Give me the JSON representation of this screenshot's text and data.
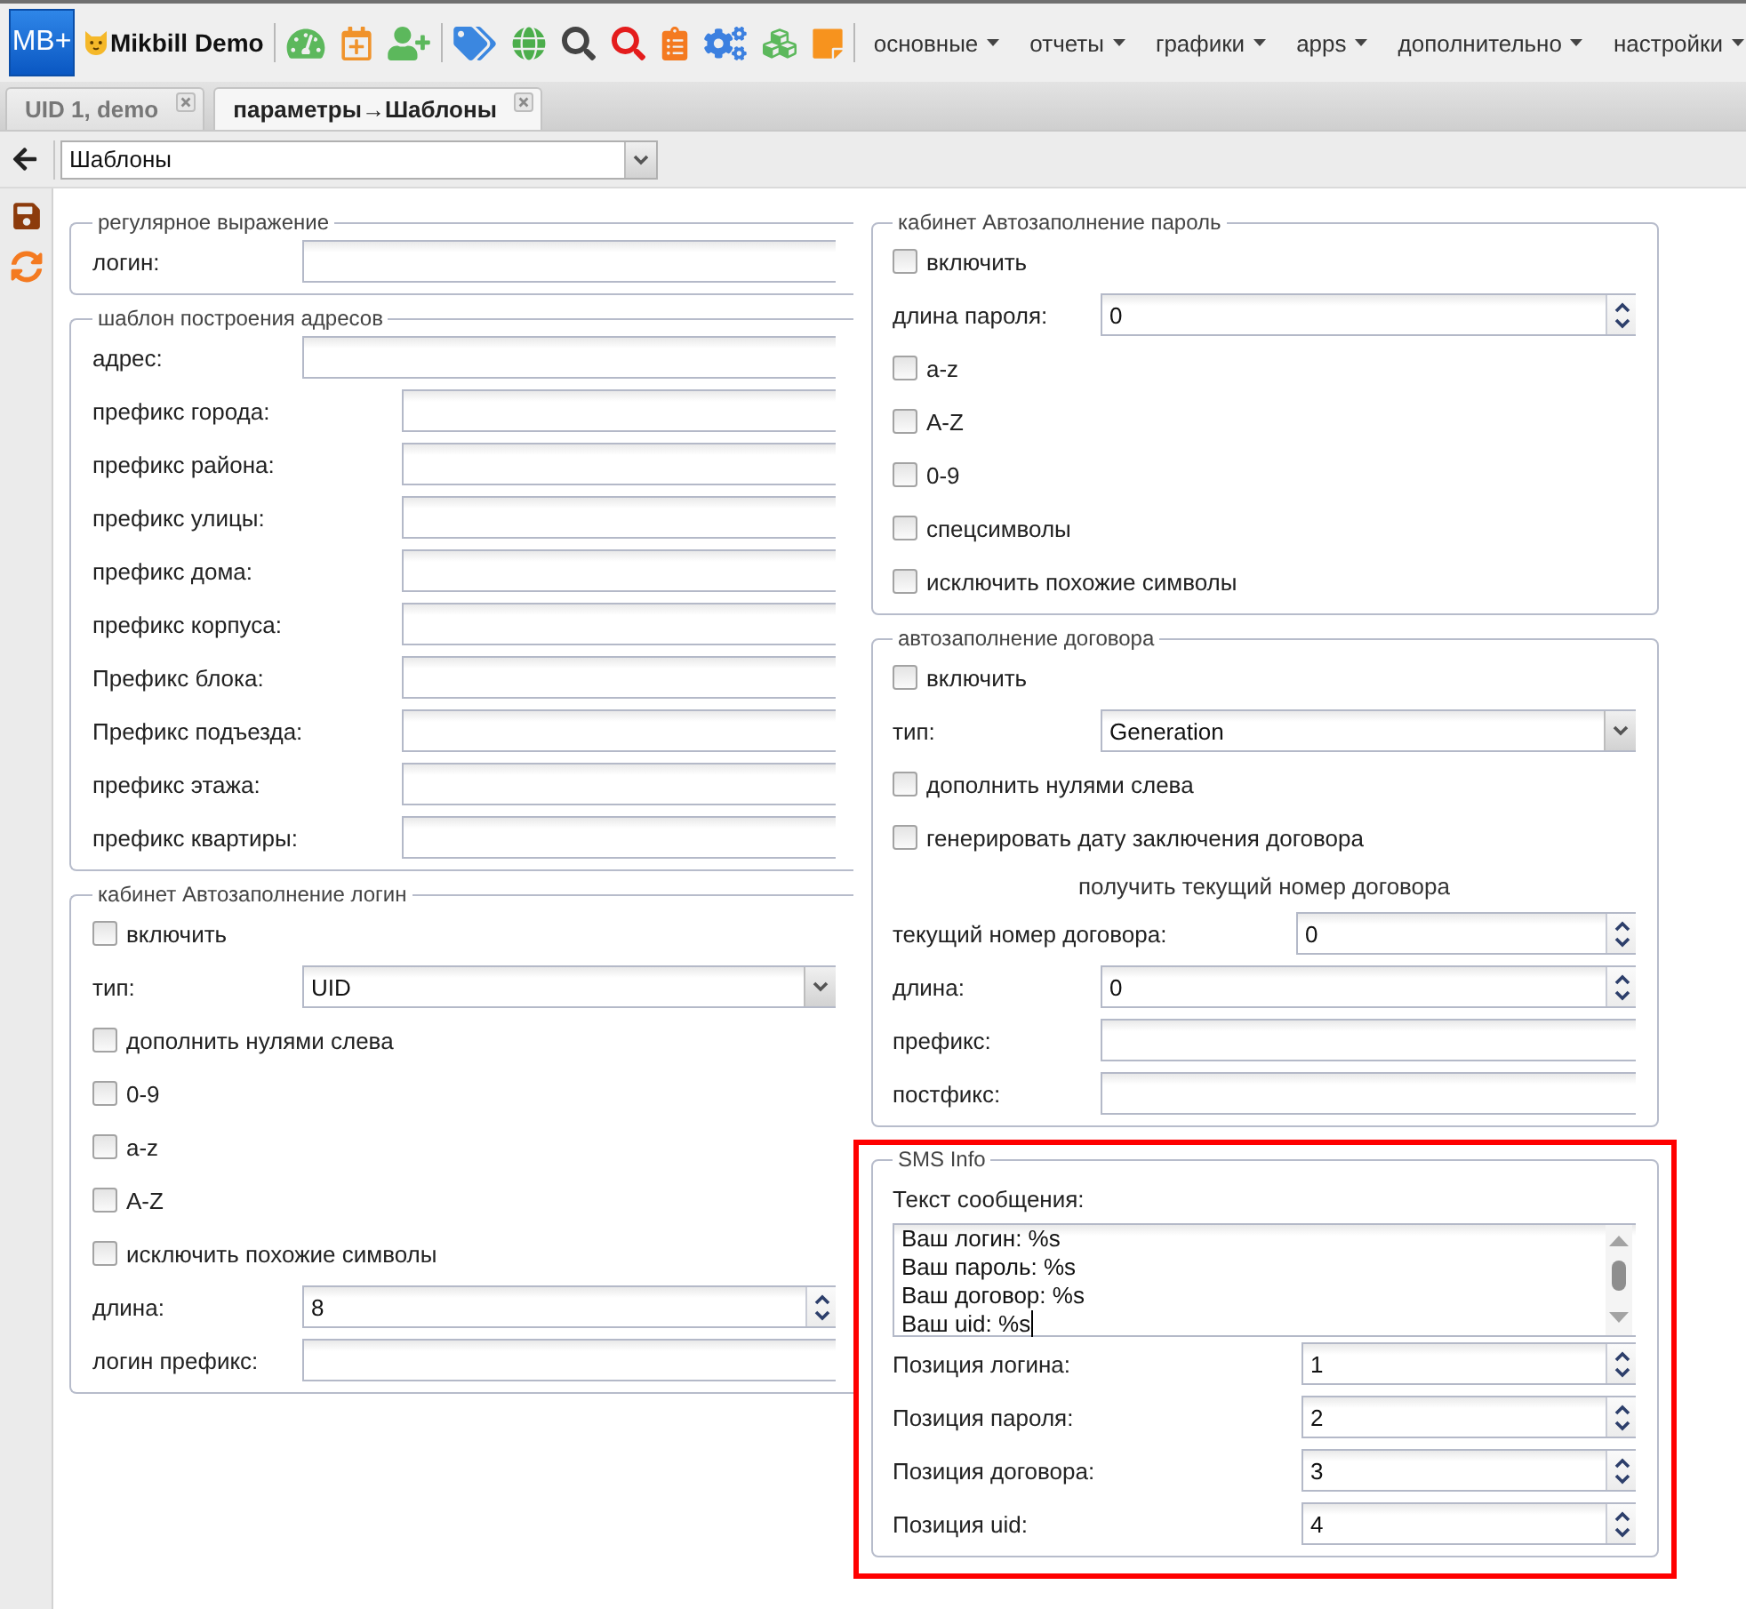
{
  "header": {
    "logo": "MB+",
    "brand": "Mikbill Demo",
    "menu": [
      "основные",
      "отчеты",
      "графики",
      "apps",
      "дополнительно",
      "настройки"
    ]
  },
  "tabs": [
    {
      "label": "UID 1, demo",
      "selected": false
    },
    {
      "label": "параметры→Шаблоны",
      "selected": true
    }
  ],
  "toolbar": {
    "page_select": {
      "value": "Шаблоны"
    }
  },
  "left_column": {
    "sections": [
      {
        "legend": "регулярное выражение",
        "highlighted": false,
        "rows": [
          {
            "kind": "text",
            "label": "логин:"
          }
        ]
      },
      {
        "legend": "шаблон построения адресов",
        "highlighted": false,
        "rows": [
          {
            "kind": "text",
            "label": "адрес:"
          },
          {
            "kind": "text",
            "label": "префикс города:"
          },
          {
            "kind": "text",
            "label": "префикс района:"
          },
          {
            "kind": "text",
            "label": "префикс улицы:"
          },
          {
            "kind": "text",
            "label": "префикс дома:"
          },
          {
            "kind": "text",
            "label": "префикс корпуса:"
          },
          {
            "kind": "text",
            "label": "Префикс блока:"
          },
          {
            "kind": "text",
            "label": "Префикс подъезда:"
          },
          {
            "kind": "text",
            "label": "префикс этажа:"
          },
          {
            "kind": "text",
            "label": "префикс квартиры:"
          }
        ]
      },
      {
        "legend": "кабинет Автозаполнение логин",
        "highlighted": false,
        "rows": [
          {
            "kind": "checkbox",
            "label": "включить",
            "checked": false
          },
          {
            "kind": "select",
            "label": "тип:",
            "value": "UID"
          },
          {
            "kind": "checkbox",
            "label": "дополнить нулями слева",
            "checked": false
          },
          {
            "kind": "checkbox",
            "label": "0-9",
            "checked": false
          },
          {
            "kind": "checkbox",
            "label": "a-z",
            "checked": false
          },
          {
            "kind": "checkbox",
            "label": "A-Z",
            "checked": false
          },
          {
            "kind": "checkbox",
            "label": "исключить похожие символы",
            "checked": false
          },
          {
            "kind": "number",
            "label": "длина:",
            "value": "8"
          },
          {
            "kind": "text",
            "label": "логин префикс:"
          }
        ]
      }
    ]
  },
  "right_column": {
    "sections": [
      {
        "legend": "кабинет Автозаполнение пароль",
        "highlighted": false,
        "rows": [
          {
            "kind": "checkbox",
            "label": "включить",
            "checked": false
          },
          {
            "kind": "number",
            "label": "длина пароля:",
            "value": "0"
          },
          {
            "kind": "checkbox",
            "label": "a-z",
            "checked": false
          },
          {
            "kind": "checkbox",
            "label": "A-Z",
            "checked": false
          },
          {
            "kind": "checkbox",
            "label": "0-9",
            "checked": false
          },
          {
            "kind": "checkbox",
            "label": "спецсимволы",
            "checked": false
          },
          {
            "kind": "checkbox",
            "label": "исключить похожие символы",
            "checked": false
          }
        ]
      },
      {
        "legend": "автозаполнение договора",
        "highlighted": false,
        "rows": [
          {
            "kind": "checkbox",
            "label": "включить",
            "checked": false
          },
          {
            "kind": "select",
            "label": "тип:",
            "value": "Generation"
          },
          {
            "kind": "checkbox",
            "label": "дополнить нулями слева",
            "checked": false
          },
          {
            "kind": "checkbox",
            "label": "генерировать дату заключения договора",
            "checked": false
          },
          {
            "kind": "heading",
            "text": "получить текущий номер договора"
          },
          {
            "kind": "number",
            "label": "текущий номер договора:",
            "value": "0"
          },
          {
            "kind": "number",
            "label": "длина:",
            "value": "0"
          },
          {
            "kind": "text",
            "label": "префикс:"
          },
          {
            "kind": "text",
            "label": "постфикс:"
          }
        ]
      },
      {
        "legend": "SMS Info",
        "highlighted": true,
        "rows": [
          {
            "kind": "textarea",
            "label": "Текст сообщения:",
            "value": "Ваш логин: %s\nВаш пароль: %s\nВаш договор: %s\nВаш uid: %s",
            "focused": true
          },
          {
            "kind": "number",
            "label": "Позиция логина:",
            "value": "1"
          },
          {
            "kind": "number",
            "label": "Позиция пароля:",
            "value": "2"
          },
          {
            "kind": "number",
            "label": "Позиция договора:",
            "value": "3"
          },
          {
            "kind": "number",
            "label": "Позиция uid:",
            "value": "4"
          }
        ]
      }
    ]
  }
}
